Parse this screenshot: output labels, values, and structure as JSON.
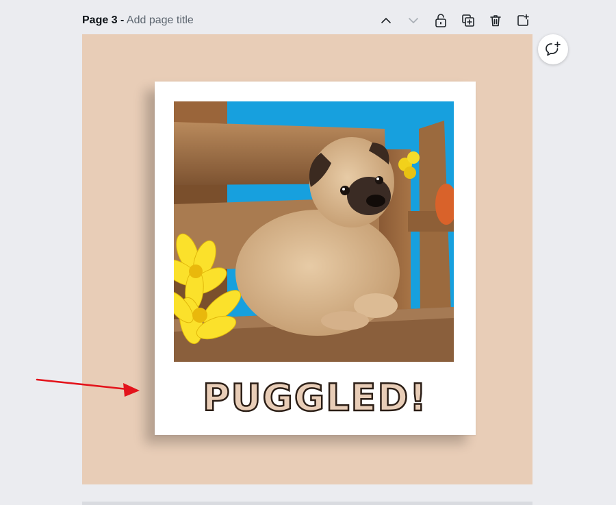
{
  "page_header": {
    "page_number_label": "Page 3 -",
    "title_placeholder": "Add page title"
  },
  "toolbar": {
    "buttons": [
      {
        "name": "move-page-up",
        "icon": "chevron-up-icon"
      },
      {
        "name": "move-page-down",
        "icon": "chevron-down-icon",
        "disabled": true
      },
      {
        "name": "lock-page",
        "icon": "lock-icon"
      },
      {
        "name": "duplicate-page",
        "icon": "duplicate-icon"
      },
      {
        "name": "delete-page",
        "icon": "trash-icon"
      },
      {
        "name": "add-page",
        "icon": "add-page-icon"
      }
    ]
  },
  "comment_button": {
    "icon": "comment-add-icon"
  },
  "design": {
    "background_color": "#e8cdb7",
    "frame_color": "#ffffff",
    "caption": "PUGGLED!",
    "caption_fill": "#e8cdb7",
    "caption_outline": "#2b1e16",
    "photo_subject": "pug puppy on wooden bench with yellow flowers"
  },
  "annotation": {
    "icon": "red-arrow-icon",
    "color": "#e3131b"
  }
}
